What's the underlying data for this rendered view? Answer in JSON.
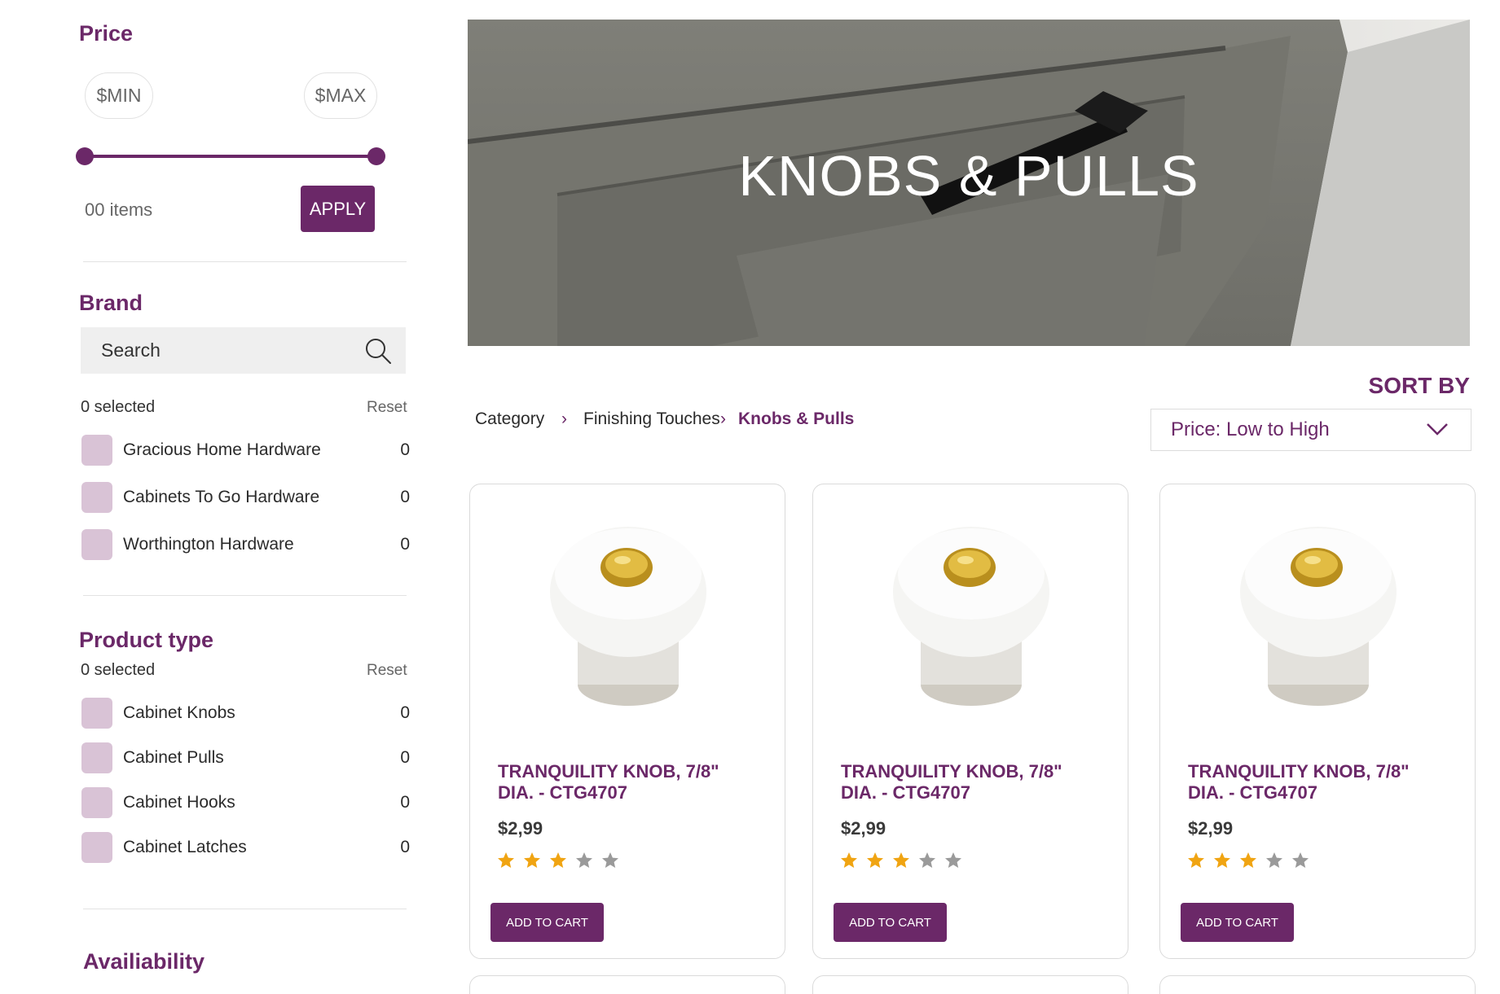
{
  "filters": {
    "price": {
      "title": "Price",
      "min_placeholder": "$MIN",
      "max_placeholder": "$MAX",
      "items_label": "00 items",
      "apply_label": "APPLY"
    },
    "brand": {
      "title": "Brand",
      "search_placeholder": "Search",
      "selected_label": "0 selected",
      "reset_label": "Reset",
      "options": [
        {
          "label": "Gracious Home Hardware",
          "count": "0"
        },
        {
          "label": "Cabinets To Go Hardware",
          "count": "0"
        },
        {
          "label": "Worthington Hardware",
          "count": "0"
        }
      ]
    },
    "product_type": {
      "title": "Product type",
      "selected_label": "0 selected",
      "reset_label": "Reset",
      "options": [
        {
          "label": "Cabinet Knobs",
          "count": "0"
        },
        {
          "label": "Cabinet Pulls",
          "count": "0"
        },
        {
          "label": "Cabinet Hooks",
          "count": "0"
        },
        {
          "label": "Cabinet Latches",
          "count": "0"
        }
      ]
    },
    "availability": {
      "title": "Availiability"
    }
  },
  "hero": {
    "title": "KNOBS & PULLS"
  },
  "breadcrumb": {
    "items": [
      "Category",
      "Finishing Touches",
      "Knobs & Pulls"
    ],
    "separator": "›"
  },
  "sort": {
    "label": "SORT BY",
    "selected": "Price: Low to High"
  },
  "products": [
    {
      "title": "TRANQUILITY KNOB, 7/8\" DIA. - CTG4707",
      "price": "$2,99",
      "rating": 3,
      "rating_max": 5,
      "cart_label": "ADD TO CART"
    },
    {
      "title": "TRANQUILITY KNOB, 7/8\" DIA. - CTG4707",
      "price": "$2,99",
      "rating": 3,
      "rating_max": 5,
      "cart_label": "ADD TO CART"
    },
    {
      "title": "TRANQUILITY KNOB, 7/8\" DIA. - CTG4707",
      "price": "$2,99",
      "rating": 3,
      "rating_max": 5,
      "cart_label": "ADD TO CART"
    }
  ],
  "colors": {
    "brand": "#6b2868",
    "checkbox": "#d9c3d6",
    "star_filled": "#f0a412",
    "star_empty": "#9a9a9a"
  }
}
